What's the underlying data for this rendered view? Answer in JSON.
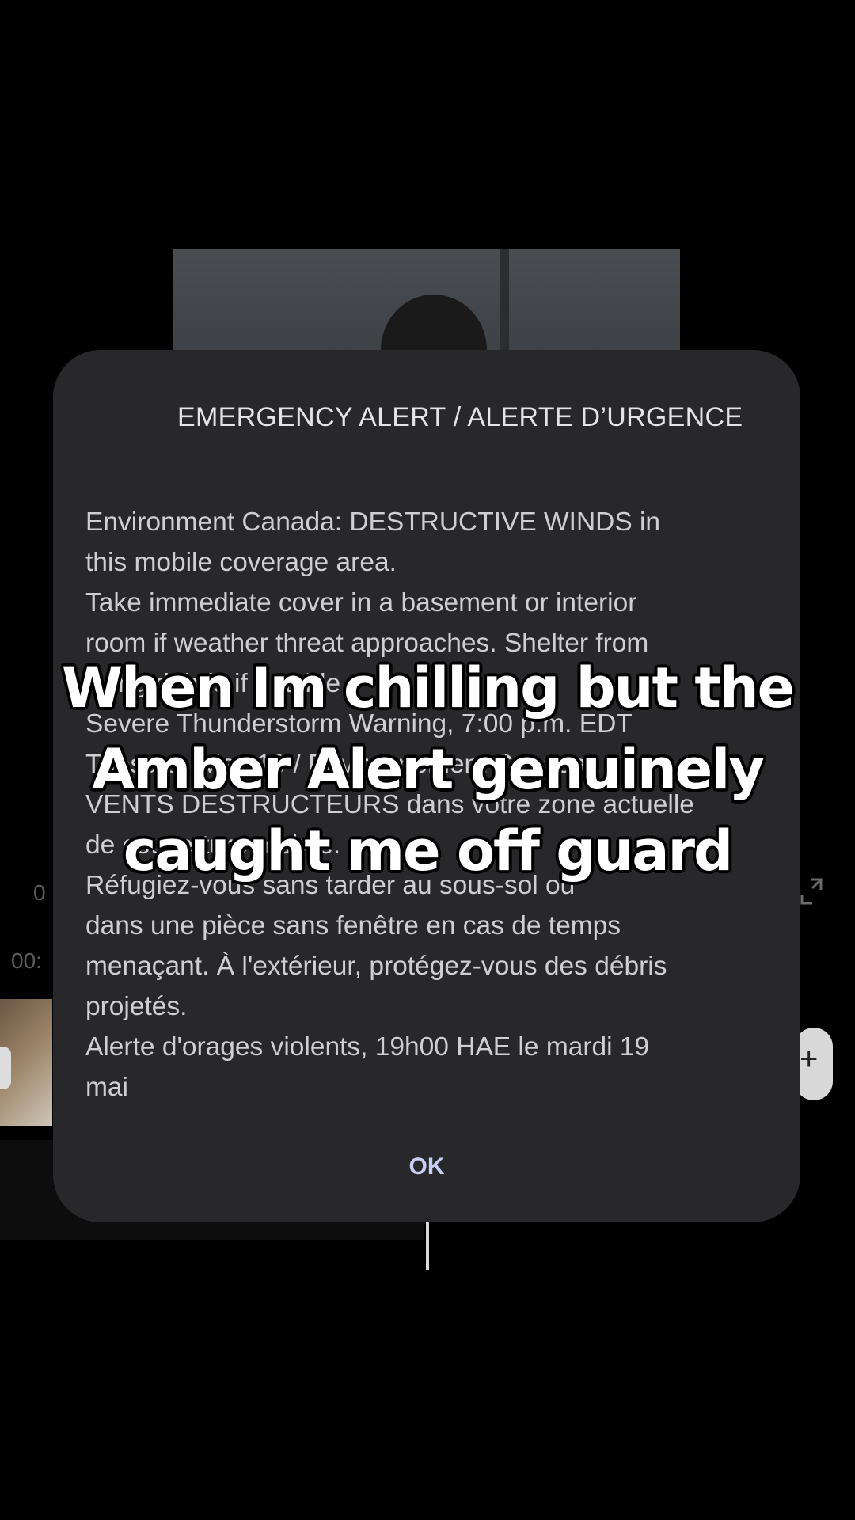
{
  "background": {
    "time_top": "0",
    "time_bottom": "00:",
    "add_glyph": "+"
  },
  "dialog": {
    "title": "EMERGENCY ALERT / ALERTE D’URGENCE",
    "lines": [
      "Environment Canada: DESTRUCTIVE WINDS in",
      "this mobile coverage area.",
      "Take immediate cover in a basement or interior",
      "room if weather threat approaches. Shelter from",
      "flying debris if outside.",
      "Severe Thunderstorm Warning, 7:00 p.m. EDT",
      "Tuesday, May 19 / Environnement Canada :",
      "VENTS DESTRUCTEURS dans votre zone actuelle",
      "de couverture mobile.",
      "Réfugiez-vous sans tarder au sous-sol ou",
      "dans une pièce sans fenêtre en cas de temps",
      "menaçant. À l'extérieur, protégez-vous des débris",
      "projetés.",
      "Alerte d'orages violents, 19h00 HAE le mardi 19",
      "mai"
    ],
    "ok_label": "OK"
  },
  "caption": {
    "lines": [
      "When Im chilling but the",
      "Amber Alert genuinely",
      "caught me off guard"
    ]
  },
  "colors": {
    "dialog_bg": "#28282a",
    "ok_accent": "#c9cff4"
  }
}
